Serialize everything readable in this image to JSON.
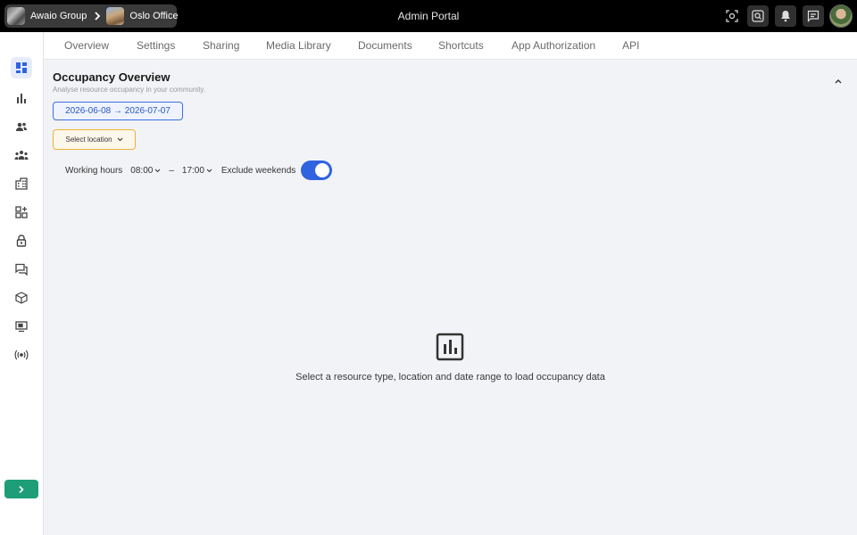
{
  "breadcrumb": {
    "org_label": "Awaio Group",
    "site_label": "Oslo Office"
  },
  "app": {
    "title": "Admin Portal"
  },
  "topbar": {
    "icons": [
      "scan-icon",
      "search-icon",
      "bell-icon",
      "chat-icon"
    ]
  },
  "sidebar": {
    "items": [
      {
        "icon": "dashboard-icon",
        "active": true
      },
      {
        "icon": "bar-chart-icon"
      },
      {
        "icon": "users-icon"
      },
      {
        "icon": "group-icon"
      },
      {
        "icon": "building-icon"
      },
      {
        "icon": "apps-add-icon"
      },
      {
        "icon": "lock-icon"
      },
      {
        "icon": "messages-icon"
      },
      {
        "icon": "package-icon"
      },
      {
        "icon": "display-icon"
      },
      {
        "icon": "broadcast-icon"
      }
    ],
    "expand_icon": "chevron-right-icon"
  },
  "tabs": [
    "Overview",
    "Settings",
    "Sharing",
    "Media Library",
    "Documents",
    "Shortcuts",
    "App Authorization",
    "API"
  ],
  "page": {
    "title": "Occupancy Overview",
    "subtitle": "Analyse resource occupancy in your community.",
    "date_range": "2026-06-08 → 2026-07-07",
    "location_placeholder": "Select location",
    "working_hours_label": "Working hours",
    "start_time": "08:00",
    "time_separator": "–",
    "end_time": "17:00",
    "exclude_weekends_label": "Exclude weekends",
    "exclude_weekends": true,
    "empty_state_icon": "chart-icon",
    "empty_state_text": "Select a resource type, location and date range to load occupancy data"
  },
  "colors": {
    "accent": "#2f63df",
    "expand": "#1e9e77",
    "warning_border": "#eab23c"
  }
}
